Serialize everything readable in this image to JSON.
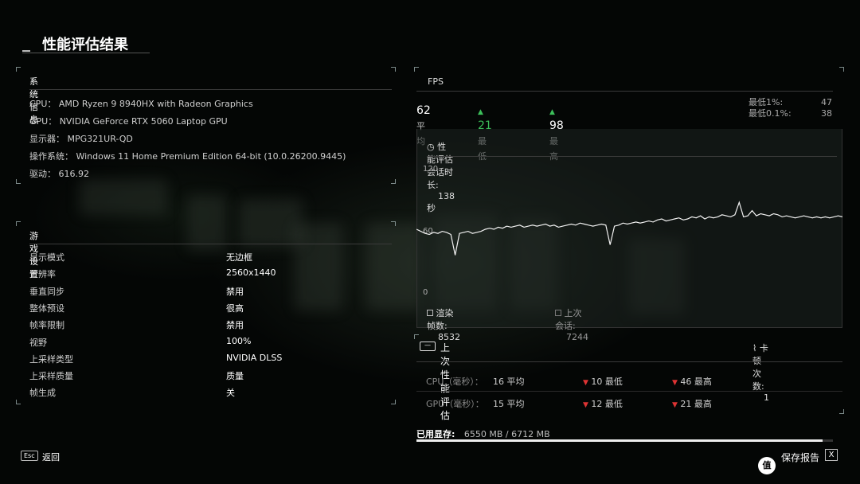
{
  "page": {
    "title": "性能评估结果"
  },
  "system_info": {
    "header": "系统信息",
    "cpu": "CPU： AMD Ryzen 9 8940HX with Radeon Graphics",
    "gpu": "GPU： NVIDIA GeForce RTX 5060 Laptop GPU",
    "display": "显示器： MPG321UR-QD",
    "os": "操作系统： Windows 11 Home Premium Edition 64-bit (10.0.26200.9445)",
    "driver": "驱动： 616.92"
  },
  "game_settings": {
    "header": "游戏设置",
    "rows": [
      {
        "k": "显示模式",
        "v": "无边框"
      },
      {
        "k": "分辨率",
        "v": "2560x1440"
      },
      {
        "k": "垂直同步",
        "v": "禁用"
      },
      {
        "k": "整体预设",
        "v": "很高"
      },
      {
        "k": "帧率限制",
        "v": "禁用"
      },
      {
        "k": "视野",
        "v": "100%"
      },
      {
        "k": "上采样类型",
        "v": "NVIDIA DLSS"
      },
      {
        "k": "上采样质量",
        "v": "质量"
      },
      {
        "k": "帧生成",
        "v": "关"
      }
    ]
  },
  "fps": {
    "header": "FPS",
    "avg": "62",
    "avg_label": "平均",
    "min": "21",
    "min_label": "最低",
    "max": "98",
    "max_label": "最高",
    "low1_label": "最低1%:",
    "low1": "47",
    "low01_label": "最低0.1%:",
    "low01": "38",
    "session_label": "性能评估会话时长:",
    "session_value": "138秒",
    "rendered_label": "渲染帧数:",
    "rendered_value": "8532",
    "last_label": "上次会话:",
    "last_value": "7244"
  },
  "chart_data": {
    "type": "line",
    "ylim": [
      0,
      120
    ],
    "yticks": [
      "120",
      "60",
      "0"
    ],
    "series": [
      {
        "values": [
          60,
          58,
          56,
          55,
          57,
          56,
          58,
          57,
          55,
          35,
          56,
          57,
          58,
          56,
          57,
          58,
          60,
          61,
          60,
          62,
          61,
          63,
          62,
          63,
          64,
          62,
          63,
          64,
          63,
          64,
          65,
          63,
          64,
          62,
          63,
          64,
          65,
          64,
          66,
          65,
          64,
          63,
          64,
          65,
          64,
          45,
          63,
          64,
          66,
          65,
          66,
          67,
          66,
          67,
          68,
          67,
          69,
          70,
          68,
          69,
          70,
          71,
          69,
          70,
          72,
          71,
          73,
          70,
          72,
          71,
          72,
          74,
          73,
          72,
          74,
          86,
          72,
          73,
          78,
          73,
          75,
          74,
          73,
          75,
          74,
          72,
          73,
          72,
          71,
          72,
          73,
          72,
          71,
          72,
          71,
          72,
          71,
          72,
          73,
          72
        ]
      }
    ]
  },
  "last_eval": {
    "header": "上次性能评估",
    "stutter_label": "卡顿次数:",
    "stutter_value": "1",
    "cpu_label": "CPU（毫秒）：",
    "cpu_avg": "16 平均",
    "cpu_min": "10 最低",
    "cpu_max": "46 最高",
    "gpu_label": "GPU（毫秒）：",
    "gpu_avg": "15 平均",
    "gpu_min": "12 最低",
    "gpu_max": "21 最高"
  },
  "vram": {
    "label": "已用显存:",
    "value": "6550 MB / 6712 MB",
    "fraction": 0.976
  },
  "footer": {
    "esc_key": "Esc",
    "back": "返回",
    "save": "保存报告",
    "x_key": "X"
  }
}
